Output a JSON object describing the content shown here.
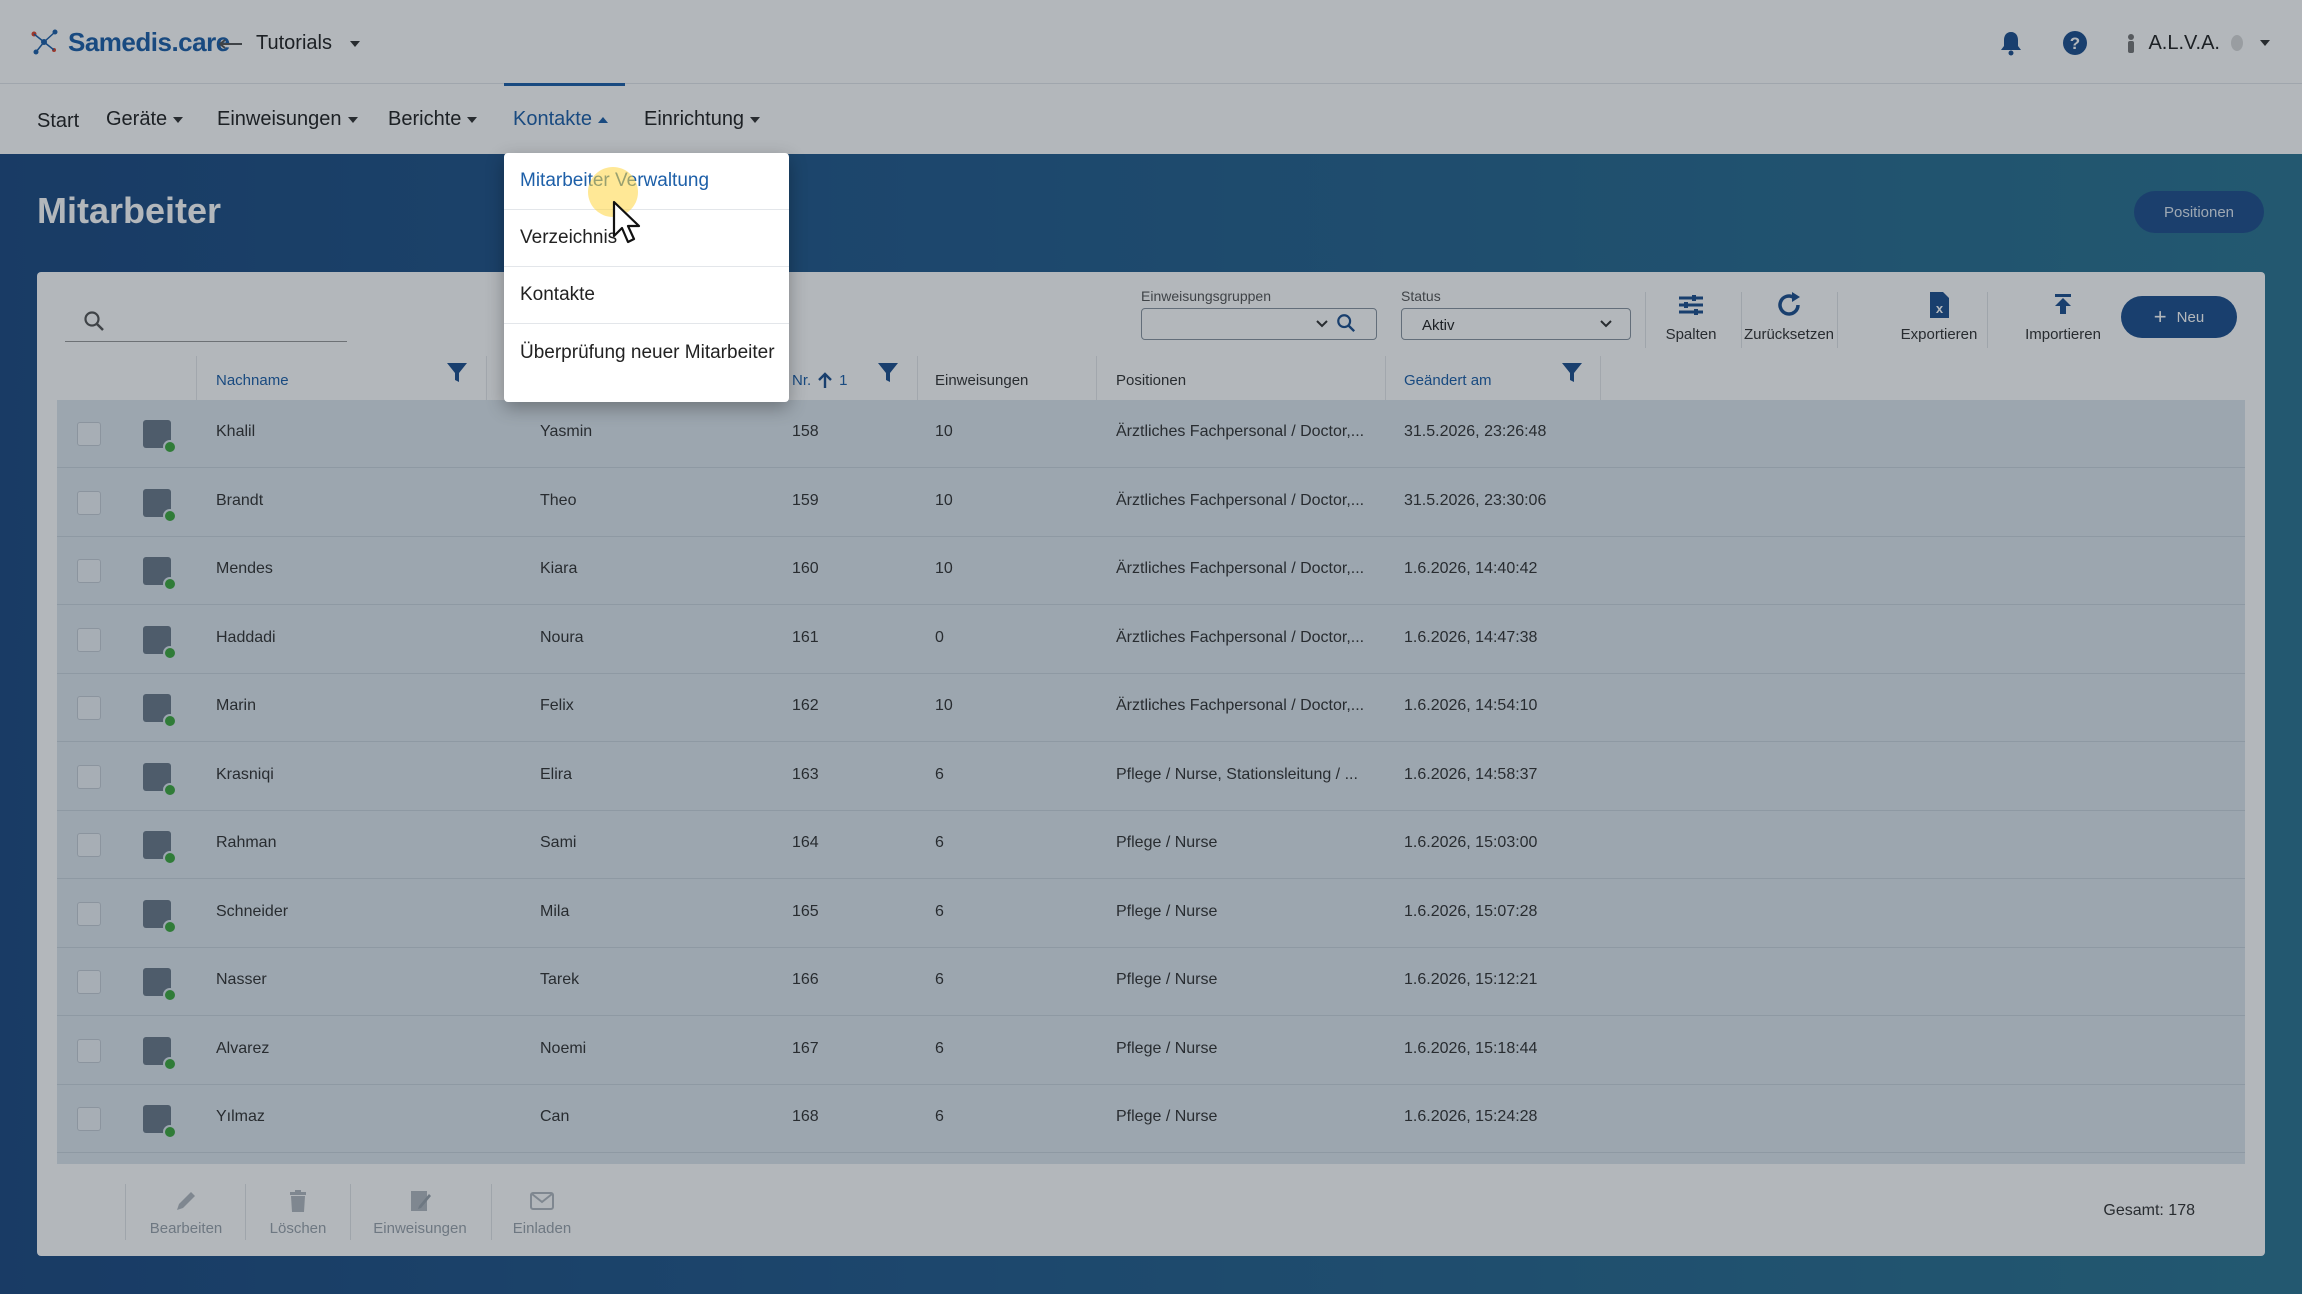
{
  "header": {
    "logo_text": "Samedis.care",
    "workspace": "Tutorials",
    "user": "A.L.V.A.",
    "icons": [
      "bell-icon",
      "help-icon",
      "user-icon"
    ]
  },
  "nav": {
    "items": [
      "Start",
      "Geräte",
      "Einweisungen",
      "Berichte",
      "Kontakte",
      "Einrichtung"
    ],
    "active": "Kontakte"
  },
  "page": {
    "title": "Mitarbeiter",
    "positions_button": "Positionen"
  },
  "toolbar": {
    "search_placeholder": "",
    "group_label": "Einweisungsgruppen",
    "group_value": "",
    "status_label": "Status",
    "status_value": "Aktiv",
    "columns_label": "Spalten",
    "reset_label": "Zurücksetzen",
    "export_label": "Exportieren",
    "import_label": "Importieren",
    "new_label": "Neu"
  },
  "table": {
    "headers": {
      "lastname": "Nachname",
      "nr": "Nr.",
      "nr_sort": "1",
      "trainings": "Einweisungen",
      "positions": "Positionen",
      "changed": "Geändert am"
    },
    "rows": [
      {
        "lastname": "Khalil",
        "firstname": "Yasmin",
        "nr": "158",
        "trainings": "10",
        "positions": "Ärztliches Fachpersonal / Doctor,...",
        "changed": "31.5.2026, 23:26:48"
      },
      {
        "lastname": "Brandt",
        "firstname": "Theo",
        "nr": "159",
        "trainings": "10",
        "positions": "Ärztliches Fachpersonal / Doctor,...",
        "changed": "31.5.2026, 23:30:06"
      },
      {
        "lastname": "Mendes",
        "firstname": "Kiara",
        "nr": "160",
        "trainings": "10",
        "positions": "Ärztliches Fachpersonal / Doctor,...",
        "changed": "1.6.2026, 14:40:42"
      },
      {
        "lastname": "Haddadi",
        "firstname": "Noura",
        "nr": "161",
        "trainings": "0",
        "positions": "Ärztliches Fachpersonal / Doctor,...",
        "changed": "1.6.2026, 14:47:38"
      },
      {
        "lastname": "Marin",
        "firstname": "Felix",
        "nr": "162",
        "trainings": "10",
        "positions": "Ärztliches Fachpersonal / Doctor,...",
        "changed": "1.6.2026, 14:54:10"
      },
      {
        "lastname": "Krasniqi",
        "firstname": "Elira",
        "nr": "163",
        "trainings": "6",
        "positions": "Pflege / Nurse, Stationsleitung / ...",
        "changed": "1.6.2026, 14:58:37"
      },
      {
        "lastname": "Rahman",
        "firstname": "Sami",
        "nr": "164",
        "trainings": "6",
        "positions": "Pflege / Nurse",
        "changed": "1.6.2026, 15:03:00"
      },
      {
        "lastname": "Schneider",
        "firstname": "Mila",
        "nr": "165",
        "trainings": "6",
        "positions": "Pflege / Nurse",
        "changed": "1.6.2026, 15:07:28"
      },
      {
        "lastname": "Nasser",
        "firstname": "Tarek",
        "nr": "166",
        "trainings": "6",
        "positions": "Pflege / Nurse",
        "changed": "1.6.2026, 15:12:21"
      },
      {
        "lastname": "Alvarez",
        "firstname": "Noemi",
        "nr": "167",
        "trainings": "6",
        "positions": "Pflege / Nurse",
        "changed": "1.6.2026, 15:18:44"
      },
      {
        "lastname": "Yılmaz",
        "firstname": "Can",
        "nr": "168",
        "trainings": "6",
        "positions": "Pflege / Nurse",
        "changed": "1.6.2026, 15:24:28"
      }
    ]
  },
  "footer": {
    "edit_label": "Bearbeiten",
    "delete_label": "Löschen",
    "trainings_label": "Einweisungen",
    "invite_label": "Einladen",
    "total": "Gesamt: 178"
  },
  "dropdown": {
    "items": [
      "Mitarbeiter Verwaltung",
      "Verzeichnis",
      "Kontakte",
      "Überprüfung neuer Mitarbeiter"
    ]
  },
  "colors": {
    "brand": "#1d5fa8",
    "status_online": "#3fa83f",
    "page_bg": "#1c4a7e"
  }
}
